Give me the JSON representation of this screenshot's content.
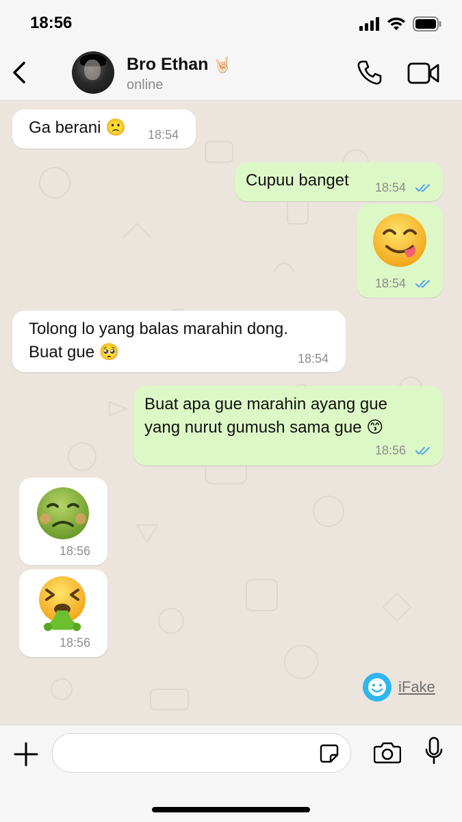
{
  "status_bar": {
    "time": "18:56",
    "icons": [
      "cellular-signal-icon",
      "wifi-icon",
      "battery-icon"
    ]
  },
  "header": {
    "contact_name": "Bro Ethan",
    "contact_emoji": "🤘🏻",
    "contact_status": "online",
    "icons": [
      "back-arrow-icon",
      "phone-icon",
      "video-camera-icon"
    ]
  },
  "messages": [
    {
      "direction": "in",
      "text": "Ga berani 🙁",
      "time": "18:54"
    },
    {
      "direction": "out",
      "text": "Cupuu banget",
      "time": "18:54",
      "read": true
    },
    {
      "direction": "out",
      "emoji": "face-savoring-food",
      "time": "18:54",
      "read": true
    },
    {
      "direction": "in",
      "text": "Tolong lo yang balas marahin dong.\nBuat gue 🥺",
      "time": "18:54"
    },
    {
      "direction": "out",
      "text": "Buat apa gue marahin ayang gue\nyang nurut gumush sama gue 😙",
      "time": "18:56",
      "read": true
    },
    {
      "direction": "in",
      "emoji": "nauseated-face",
      "time": "18:56"
    },
    {
      "direction": "in",
      "emoji": "face-vomiting",
      "time": "18:56"
    }
  ],
  "watermark": {
    "text": "iFake"
  },
  "input_bar": {
    "placeholder": "",
    "icons": [
      "plus-icon",
      "sticker-icon",
      "camera-icon",
      "microphone-icon"
    ]
  },
  "colors": {
    "incoming": "#ffffff",
    "outgoing": "#dcf8c6",
    "read_ticks": "#4fa3e8",
    "chat_bg": "#ece5dd"
  }
}
